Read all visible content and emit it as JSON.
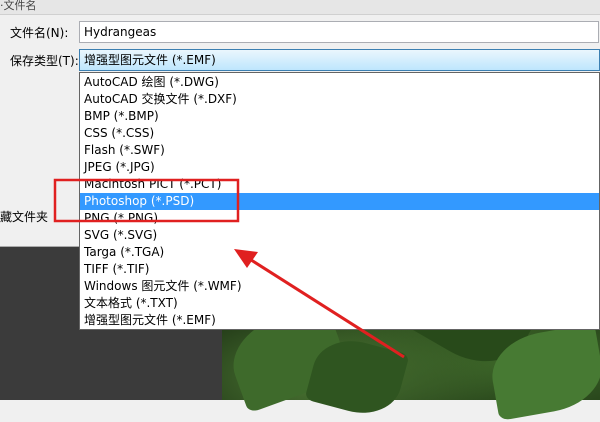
{
  "dialog": {
    "top_label": "·文件名",
    "filename_label": "文件名(N):",
    "filename_value": "Hydrangeas",
    "type_label": "保存类型(T):",
    "type_selected": "增强型图元文件 (*.EMF)",
    "hidden_folders_label": "藏文件夹"
  },
  "file_types": [
    "AutoCAD 绘图 (*.DWG)",
    "AutoCAD 交换文件 (*.DXF)",
    "BMP (*.BMP)",
    "CSS (*.CSS)",
    "Flash (*.SWF)",
    "JPEG (*.JPG)",
    "Macintosh PICT (*.PCT)",
    "Photoshop (*.PSD)",
    "PNG (*.PNG)",
    "SVG (*.SVG)",
    "Targa (*.TGA)",
    "TIFF (*.TIF)",
    "Windows 图元文件 (*.WMF)",
    "文本格式 (*.TXT)",
    "增强型图元文件 (*.EMF)"
  ],
  "highlighted_index": 7,
  "colors": {
    "selection": "#3399ff",
    "annotation": "#e02020",
    "dialog_bg": "#f0f0f0"
  }
}
